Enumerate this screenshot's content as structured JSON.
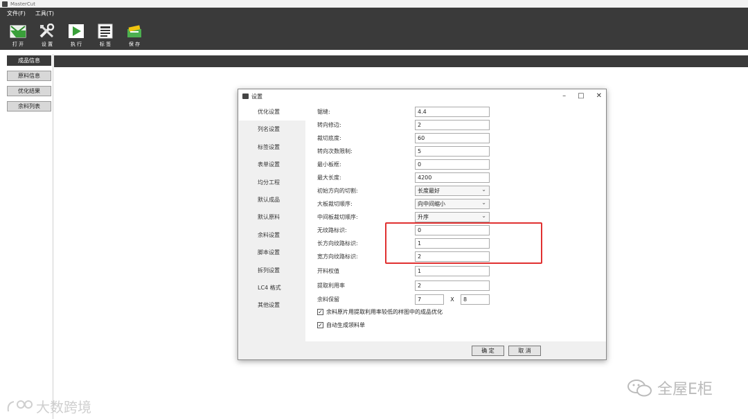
{
  "window": {
    "title": "MasterCut"
  },
  "menu": [
    "文件(F)",
    "工具(T)"
  ],
  "toolbar": [
    {
      "label": "打 开",
      "icon": "open-icon"
    },
    {
      "label": "设 置",
      "icon": "tools-icon"
    },
    {
      "label": "执 行",
      "icon": "run-icon"
    },
    {
      "label": "标 签",
      "icon": "label-icon"
    },
    {
      "label": "保 存",
      "icon": "save-icon"
    }
  ],
  "sidebar": [
    "成品信息",
    "原料信息",
    "优化结果",
    "余料列表"
  ],
  "dialog": {
    "title": "设置",
    "controls": {
      "minimize": "–",
      "maximize": "□",
      "close": "✕"
    },
    "nav": [
      "优化设置",
      "列名设置",
      "标签设置",
      "表单设置",
      "均分工程",
      "默认成品",
      "默认原料",
      "余料设置",
      "脚本设置",
      "拆列设置",
      "LC4 格式",
      "其他设置"
    ],
    "fields": [
      {
        "label": "锯缝:",
        "value": "4.4"
      },
      {
        "label": "转向修边:",
        "value": "2"
      },
      {
        "label": "裁切底度:",
        "value": "60"
      },
      {
        "label": "转向次数限制:",
        "value": "5"
      },
      {
        "label": "最小板框:",
        "value": "0"
      },
      {
        "label": "最大长度:",
        "value": "4200"
      },
      {
        "label": "初始方向的切割:",
        "value": "长度最好"
      },
      {
        "label": "大板裁切顺序:",
        "value": "向中间缩小"
      },
      {
        "label": "中间板裁切顺序:",
        "value": "升序"
      },
      {
        "label": "无纹路标识:",
        "value": "0"
      },
      {
        "label": "长方向纹路标识:",
        "value": "1"
      },
      {
        "label": "宽方向纹路标识:",
        "value": "2"
      },
      {
        "label": "开料权值",
        "value": "1"
      },
      {
        "label": "提取利用率",
        "value": "2"
      }
    ],
    "remnant": {
      "label": "余料保留",
      "w": "7",
      "sep": "X",
      "h": "8"
    },
    "checks": [
      {
        "mark": "✓",
        "label": "余料原片用提取利用率较低的样图中的成品优化"
      },
      {
        "mark": "✓",
        "label": "自动生成领料单"
      }
    ],
    "ok": "确 定",
    "cancel": "取 消"
  },
  "watermarks": {
    "right": "全屋E柜",
    "left": "大数跨境"
  }
}
